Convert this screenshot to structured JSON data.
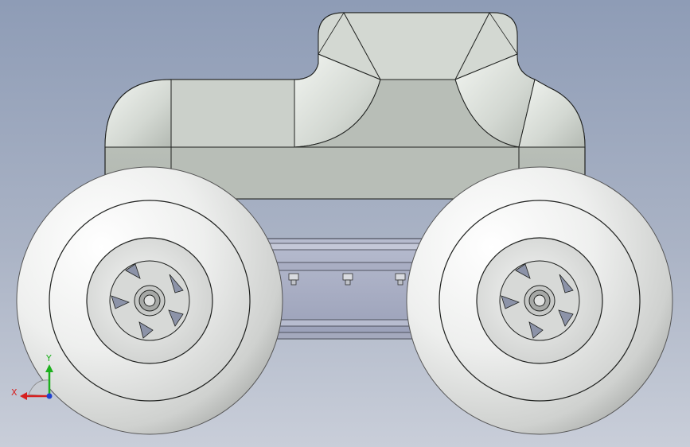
{
  "viewport": {
    "background_top": "#8e9cb6",
    "background_bottom": "#c9ced9"
  },
  "model": {
    "body_color": "#b9bfb8",
    "tire_color": "#e8e9e8",
    "edge_color": "#2b2d2b",
    "chassis_color": "#aeb3c8"
  },
  "triad": {
    "x_label": "X",
    "y_label": "Y",
    "x_color": "#d62020",
    "y_color": "#1db01d",
    "z_color": "#2040d0"
  }
}
